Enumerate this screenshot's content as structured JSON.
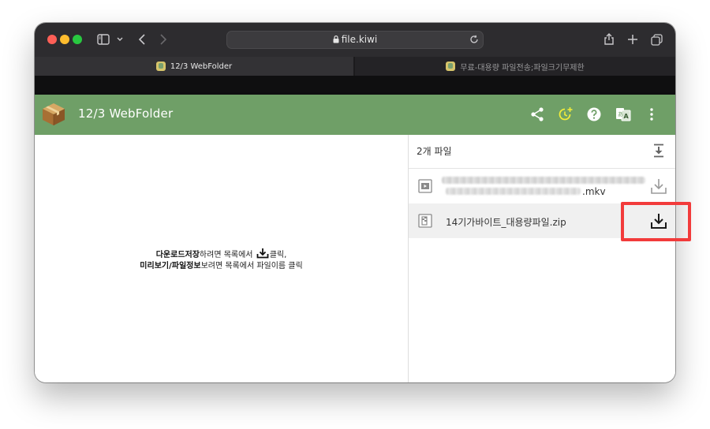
{
  "browser": {
    "url": "file.kiwi",
    "tabs": [
      {
        "label": "12/3 WebFolder",
        "active": true
      },
      {
        "label": "무료-대용량 파일전송;파일크기무제한",
        "active": false
      }
    ]
  },
  "app": {
    "title": "12/3 WebFolder",
    "accent_color": "#6f9f67",
    "toolbar_icons": [
      "share-icon",
      "timer-plus-icon",
      "help-icon",
      "translate-icon",
      "more-vert-icon"
    ]
  },
  "instructions": {
    "line1_bold": "다운로드저장",
    "line1_mid": "하려면 목록에서 ",
    "line1_end": "클릭,",
    "line2_bold": "미리보기/파일정보",
    "line2_rest": "보려면 목록에서 파일이름 클릭"
  },
  "files": {
    "count_label": "2개 파일",
    "items": [
      {
        "name_suffix": ".mkv",
        "name_obscured": true,
        "type": "video"
      },
      {
        "name": "14기가바이트_대용량파일.zip",
        "type": "archive",
        "highlighted": true
      }
    ]
  },
  "annotation": {
    "color": "#f23b3b"
  }
}
